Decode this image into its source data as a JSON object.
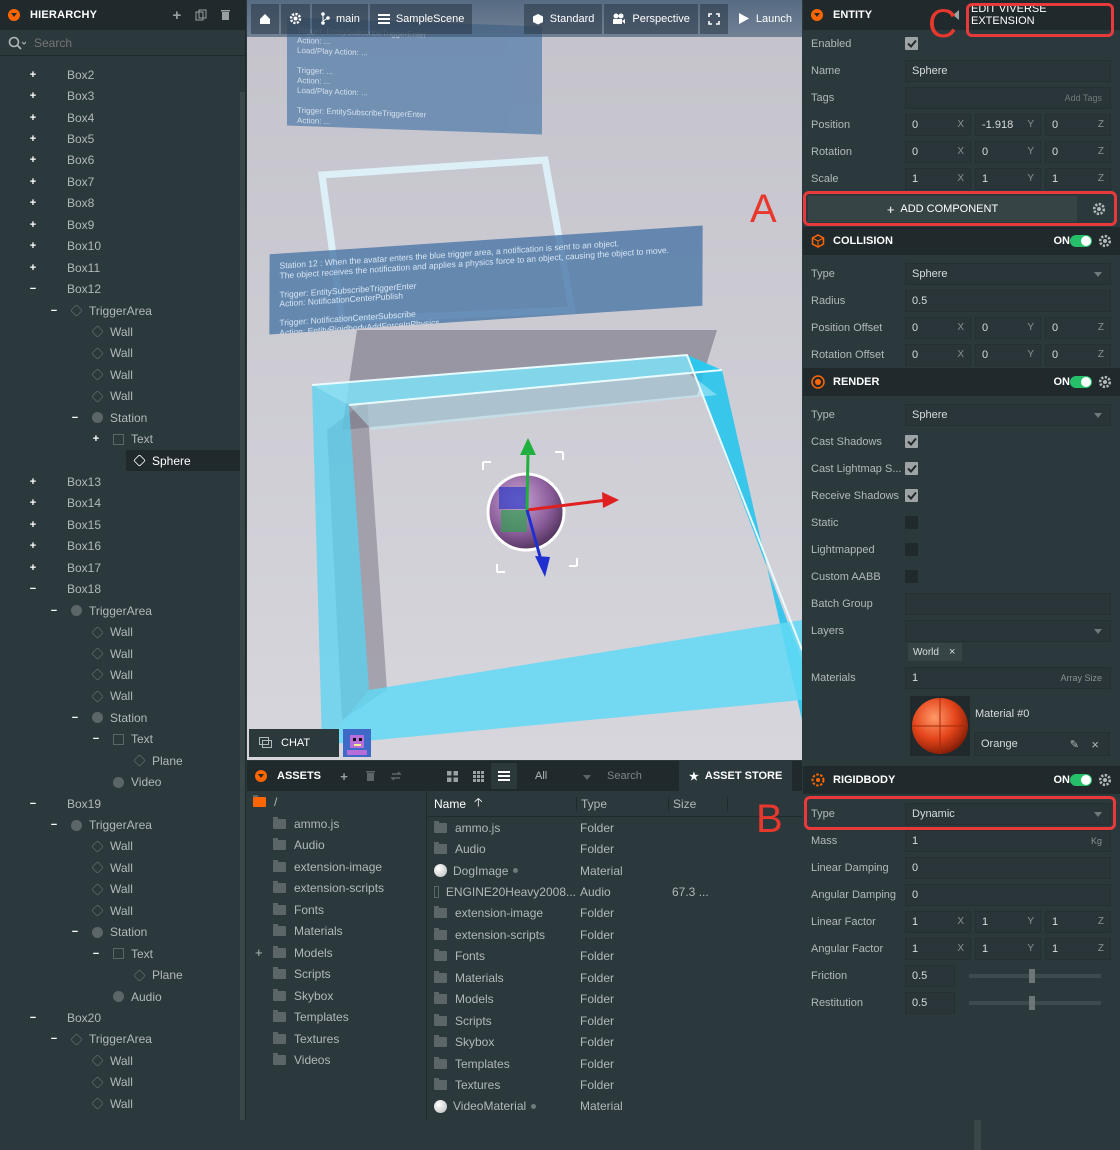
{
  "hierarchy": {
    "title": "HIERARCHY",
    "search_placeholder": "Search",
    "rows": [
      {
        "label": "Box2",
        "indent": 0,
        "toggle": "+",
        "icon": "none"
      },
      {
        "label": "Box3",
        "indent": 0,
        "toggle": "+",
        "icon": "none"
      },
      {
        "label": "Box4",
        "indent": 0,
        "toggle": "+",
        "icon": "none"
      },
      {
        "label": "Box5",
        "indent": 0,
        "toggle": "+",
        "icon": "none"
      },
      {
        "label": "Box6",
        "indent": 0,
        "toggle": "+",
        "icon": "none"
      },
      {
        "label": "Box7",
        "indent": 0,
        "toggle": "+",
        "icon": "none"
      },
      {
        "label": "Box8",
        "indent": 0,
        "toggle": "+",
        "icon": "none"
      },
      {
        "label": "Box9",
        "indent": 0,
        "toggle": "+",
        "icon": "none"
      },
      {
        "label": "Box10",
        "indent": 0,
        "toggle": "+",
        "icon": "none"
      },
      {
        "label": "Box11",
        "indent": 0,
        "toggle": "+",
        "icon": "none"
      },
      {
        "label": "Box12",
        "indent": 0,
        "toggle": "−",
        "icon": "none"
      },
      {
        "label": "TriggerArea",
        "indent": 1,
        "toggle": "−",
        "icon": "cube"
      },
      {
        "label": "Wall",
        "indent": 2,
        "toggle": "",
        "icon": "cube"
      },
      {
        "label": "Wall",
        "indent": 2,
        "toggle": "",
        "icon": "cube"
      },
      {
        "label": "Wall",
        "indent": 2,
        "toggle": "",
        "icon": "cube"
      },
      {
        "label": "Wall",
        "indent": 2,
        "toggle": "",
        "icon": "cube"
      },
      {
        "label": "Station",
        "indent": 2,
        "toggle": "−",
        "icon": "dot"
      },
      {
        "label": "Text",
        "indent": 3,
        "toggle": "+",
        "icon": "text"
      },
      {
        "label": "Sphere",
        "indent": 4,
        "toggle": "",
        "icon": "sel",
        "selected": true
      },
      {
        "label": "Box13",
        "indent": 0,
        "toggle": "+",
        "icon": "none"
      },
      {
        "label": "Box14",
        "indent": 0,
        "toggle": "+",
        "icon": "none"
      },
      {
        "label": "Box15",
        "indent": 0,
        "toggle": "+",
        "icon": "none"
      },
      {
        "label": "Box16",
        "indent": 0,
        "toggle": "+",
        "icon": "none"
      },
      {
        "label": "Box17",
        "indent": 0,
        "toggle": "+",
        "icon": "none"
      },
      {
        "label": "Box18",
        "indent": 0,
        "toggle": "−",
        "icon": "none"
      },
      {
        "label": "TriggerArea",
        "indent": 1,
        "toggle": "−",
        "icon": "dot"
      },
      {
        "label": "Wall",
        "indent": 2,
        "toggle": "",
        "icon": "cube"
      },
      {
        "label": "Wall",
        "indent": 2,
        "toggle": "",
        "icon": "cube"
      },
      {
        "label": "Wall",
        "indent": 2,
        "toggle": "",
        "icon": "cube"
      },
      {
        "label": "Wall",
        "indent": 2,
        "toggle": "",
        "icon": "cube"
      },
      {
        "label": "Station",
        "indent": 2,
        "toggle": "−",
        "icon": "dot"
      },
      {
        "label": "Text",
        "indent": 3,
        "toggle": "−",
        "icon": "text"
      },
      {
        "label": "Plane",
        "indent": 4,
        "toggle": "",
        "icon": "cube"
      },
      {
        "label": "Video",
        "indent": 3,
        "toggle": "",
        "icon": "dot"
      },
      {
        "label": "Box19",
        "indent": 0,
        "toggle": "−",
        "icon": "none"
      },
      {
        "label": "TriggerArea",
        "indent": 1,
        "toggle": "−",
        "icon": "dot"
      },
      {
        "label": "Wall",
        "indent": 2,
        "toggle": "",
        "icon": "cube"
      },
      {
        "label": "Wall",
        "indent": 2,
        "toggle": "",
        "icon": "cube"
      },
      {
        "label": "Wall",
        "indent": 2,
        "toggle": "",
        "icon": "cube"
      },
      {
        "label": "Wall",
        "indent": 2,
        "toggle": "",
        "icon": "cube"
      },
      {
        "label": "Station",
        "indent": 2,
        "toggle": "−",
        "icon": "dot"
      },
      {
        "label": "Text",
        "indent": 3,
        "toggle": "−",
        "icon": "text"
      },
      {
        "label": "Plane",
        "indent": 4,
        "toggle": "",
        "icon": "cube"
      },
      {
        "label": "Audio",
        "indent": 3,
        "toggle": "",
        "icon": "dot"
      },
      {
        "label": "Box20",
        "indent": 0,
        "toggle": "−",
        "icon": "none"
      },
      {
        "label": "TriggerArea",
        "indent": 1,
        "toggle": "−",
        "icon": "cube"
      },
      {
        "label": "Wall",
        "indent": 2,
        "toggle": "",
        "icon": "cube"
      },
      {
        "label": "Wall",
        "indent": 2,
        "toggle": "",
        "icon": "cube"
      },
      {
        "label": "Wall",
        "indent": 2,
        "toggle": "",
        "icon": "cube"
      }
    ]
  },
  "viewport": {
    "toolbar": {
      "branch": "main",
      "scene": "SampleScene",
      "render_mode": "Standard",
      "camera": "Perspective",
      "launch": "Launch"
    },
    "station_text": "Station 12 : When the avatar enters the blue trigger area, a notification is sent to an object.\nThe object receives the notification and applies a physics force to an object, causing the object to move.\n\nTrigger: EntitySubscribeTriggerEnter\nAction: NotificationCenterPublish\n\nTrigger: NotificationCenterSubscribe\nAction: EntityRigidbodyAddForceInPhysics",
    "back_panel_text": "Trigger: EntitySubscribeTriggerEnter\nAction: ...\nLoad/Play Action: ...\n\nTrigger: ...\nAction: ...\nLoad/Play Action: ...\n\nTrigger: EntitySubscribeTriggerEnter\nAction: ...\nLoad/Play Action: ...",
    "chat_label": "CHAT"
  },
  "annotations": {
    "a": "A",
    "b": "B",
    "c": "C"
  },
  "assets": {
    "title": "ASSETS",
    "filter": "All",
    "search_placeholder": "Search",
    "store_label": "ASSET STORE",
    "root": "/",
    "folders": [
      "ammo.js",
      "Audio",
      "extension-image",
      "extension-scripts",
      "Fonts",
      "Materials",
      "Models",
      "Scripts",
      "Skybox",
      "Templates",
      "Textures",
      "Videos"
    ],
    "columns": {
      "name": "Name",
      "type": "Type",
      "size": "Size"
    },
    "rows": [
      {
        "name": "ammo.js",
        "type": "Folder",
        "size": "",
        "icon": "folder"
      },
      {
        "name": "Audio",
        "type": "Folder",
        "size": "",
        "icon": "folder"
      },
      {
        "name": "DogImage",
        "type": "Material",
        "size": "",
        "icon": "material"
      },
      {
        "name": "ENGINE20Heavy2008...",
        "type": "Audio",
        "size": "67.3 ...",
        "icon": "audio"
      },
      {
        "name": "extension-image",
        "type": "Folder",
        "size": "",
        "icon": "folder"
      },
      {
        "name": "extension-scripts",
        "type": "Folder",
        "size": "",
        "icon": "folder"
      },
      {
        "name": "Fonts",
        "type": "Folder",
        "size": "",
        "icon": "folder"
      },
      {
        "name": "Materials",
        "type": "Folder",
        "size": "",
        "icon": "folder"
      },
      {
        "name": "Models",
        "type": "Folder",
        "size": "",
        "icon": "folder"
      },
      {
        "name": "Scripts",
        "type": "Folder",
        "size": "",
        "icon": "folder"
      },
      {
        "name": "Skybox",
        "type": "Folder",
        "size": "",
        "icon": "folder"
      },
      {
        "name": "Templates",
        "type": "Folder",
        "size": "",
        "icon": "folder"
      },
      {
        "name": "Textures",
        "type": "Folder",
        "size": "",
        "icon": "folder"
      },
      {
        "name": "VideoMaterial",
        "type": "Material",
        "size": "",
        "icon": "material"
      }
    ]
  },
  "inspector": {
    "entity": {
      "title": "ENTITY",
      "edit_extension": "EDIT VIVERSE EXTENSION",
      "enabled_label": "Enabled",
      "name_label": "Name",
      "name_value": "Sphere",
      "tags_label": "Tags",
      "tags_placeholder": "Add Tags",
      "position_label": "Position",
      "position": [
        "0",
        "-1.918",
        "0"
      ],
      "rotation_label": "Rotation",
      "rotation": [
        "0",
        "0",
        "0"
      ],
      "scale_label": "Scale",
      "scale": [
        "1",
        "1",
        "1"
      ],
      "add_component": "ADD COMPONENT"
    },
    "axes": [
      "X",
      "Y",
      "Z"
    ],
    "collision": {
      "title": "COLLISION",
      "on": "ON",
      "type_label": "Type",
      "type_value": "Sphere",
      "radius_label": "Radius",
      "radius": "0.5",
      "pos_offset_label": "Position Offset",
      "pos_offset": [
        "0",
        "0",
        "0"
      ],
      "rot_offset_label": "Rotation Offset",
      "rot_offset": [
        "0",
        "0",
        "0"
      ]
    },
    "render": {
      "title": "RENDER",
      "on": "ON",
      "type_label": "Type",
      "type_value": "Sphere",
      "cast_shadows": "Cast Shadows",
      "cast_lightmap": "Cast Lightmap S...",
      "receive_shadows": "Receive Shadows",
      "static": "Static",
      "lightmapped": "Lightmapped",
      "custom_aabb": "Custom AABB",
      "batch_group": "Batch Group",
      "layers": "Layers",
      "layer_tag": "World",
      "materials": "Materials",
      "materials_count": "1",
      "array_size": "Array Size",
      "material_slot": "Material #0",
      "material_name": "Orange"
    },
    "rigidbody": {
      "title": "RIGIDBODY",
      "on": "ON",
      "type_label": "Type",
      "type_value": "Dynamic",
      "mass_label": "Mass",
      "mass": "1",
      "mass_unit": "Kg",
      "linear_damping_label": "Linear Damping",
      "linear_damping": "0",
      "angular_damping_label": "Angular Damping",
      "angular_damping": "0",
      "linear_factor_label": "Linear Factor",
      "linear_factor": [
        "1",
        "1",
        "1"
      ],
      "angular_factor_label": "Angular Factor",
      "angular_factor": [
        "1",
        "1",
        "1"
      ],
      "friction_label": "Friction",
      "friction": "0.5",
      "restitution_label": "Restitution",
      "restitution": "0.5"
    }
  },
  "colors": {
    "accent": "#ff6600",
    "toggle_on": "#26c06a",
    "annotation": "#e83a3a"
  }
}
